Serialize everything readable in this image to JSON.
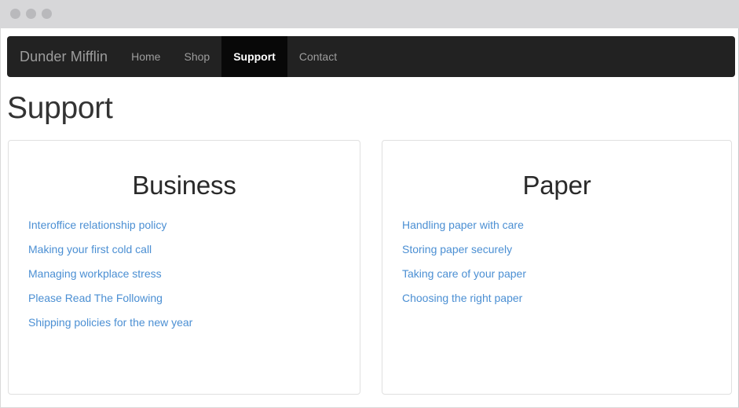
{
  "window": {
    "dots": [
      "close-dot",
      "minimize-dot",
      "maximize-dot"
    ],
    "titlebar_color": "#d7d7d9",
    "dot_color": "#b9b9bc"
  },
  "navbar": {
    "brand": "Dunder Mifflin",
    "background_color": "#222222",
    "active_background_color": "#080808",
    "link_color": "#9d9d9d",
    "items": [
      {
        "label": "Home",
        "active": false
      },
      {
        "label": "Shop",
        "active": false
      },
      {
        "label": "Support",
        "active": true
      },
      {
        "label": "Contact",
        "active": false
      }
    ]
  },
  "page": {
    "title": "Support",
    "link_color": "#4b8fd3",
    "heading_color": "#333333"
  },
  "panels": [
    {
      "title": "Business",
      "links": [
        "Interoffice relationship policy",
        "Making your first cold call",
        "Managing workplace stress",
        "Please Read The Following",
        "Shipping policies for the new year"
      ]
    },
    {
      "title": "Paper",
      "links": [
        "Handling paper with care",
        "Storing paper securely",
        "Taking care of your paper",
        "Choosing the right paper"
      ]
    }
  ]
}
